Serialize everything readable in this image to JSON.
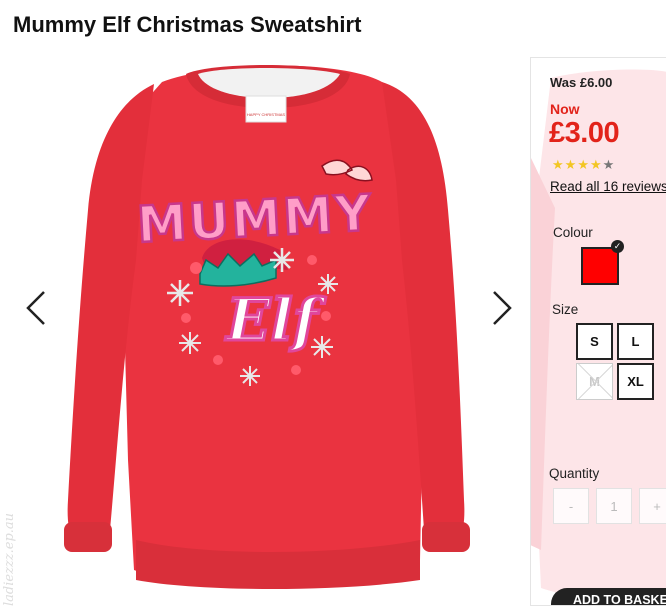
{
  "product": {
    "title": "Mummy Elf Christmas Sweatshirt"
  },
  "gallery": {
    "image_icon": "red-sweatshirt-image",
    "sweater_text_line1": "MUMMY",
    "sweater_text_line2": "Elf",
    "label_text": "HAPPY CHRISTMAS",
    "prev_icon": "chevron-left-icon",
    "next_icon": "chevron-right-icon",
    "watermark": "ladiezzz.ep.au"
  },
  "pricing": {
    "was": "Was £6.00",
    "now_label": "Now",
    "now_price": "£3.00",
    "accent_color": "#e2231a"
  },
  "reviews": {
    "rating": 4,
    "max_rating": 5,
    "star_icon": "★",
    "link_text": "Read all 16 reviews"
  },
  "colour": {
    "label": "Colour",
    "selected_color": "#ff0000",
    "check_icon": "✓"
  },
  "size": {
    "label": "Size",
    "options": [
      {
        "label": "S",
        "available": true
      },
      {
        "label": "L",
        "available": true
      },
      {
        "label": "M",
        "available": false
      },
      {
        "label": "XL",
        "available": true
      }
    ]
  },
  "quantity": {
    "label": "Quantity",
    "decrement": "-",
    "value": "1",
    "increment": "+"
  },
  "basket": {
    "label": "ADD TO BASKET"
  }
}
